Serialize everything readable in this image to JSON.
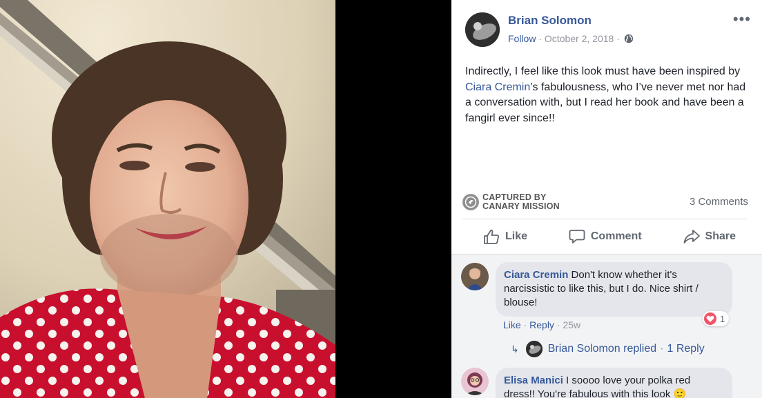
{
  "post": {
    "author": "Brian Solomon",
    "follow_label": "Follow",
    "date": "October 2, 2018",
    "separator": "·",
    "visibility_icon": "globe-icon",
    "more_icon": "more-horizontal-icon",
    "text_part1": "Indirectly, I feel like this look must have been inspired by ",
    "text_mention": "Ciara Cremin",
    "text_part2": "’s fabulousness, who I’ve never met nor had a conversation with, but I read her book and have been a fangirl ever since!!"
  },
  "captured": {
    "line1": "Captured by",
    "line2": "Canary Mission"
  },
  "comments_count": "3 Comments",
  "actions": {
    "like": "Like",
    "comment": "Comment",
    "share": "Share"
  },
  "comments": [
    {
      "author": "Ciara Cremin",
      "text": "Don't know whether it's narcissistic to like this, but I do. Nice shirt / blouse!",
      "like": "Like",
      "reply": "Reply",
      "age": "25w",
      "reaction_count": "1",
      "replies_author": "Brian Solomon replied",
      "replies_link": "1 Reply"
    },
    {
      "author": "Elisa Manici",
      "text": "I soooo love your polka red dress!! You're fabulous with this look 🙂"
    }
  ],
  "colors": {
    "link_blue": "#365899",
    "meta_gray": "#90949c",
    "heart_red": "#f25268",
    "shirt_red": "#c8102e"
  }
}
